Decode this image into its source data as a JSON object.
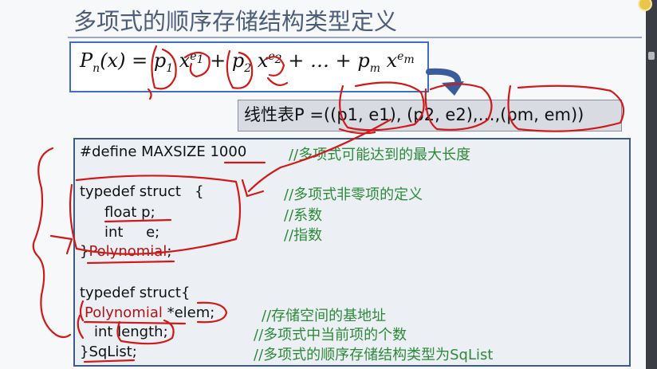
{
  "slide": {
    "title": "多项式的顺序存储结构类型定义"
  },
  "formula": {
    "lhs": "P",
    "lhs_sub": "n",
    "lhs_arg": "(x) = ",
    "t1_coef": "p",
    "t1_sub": "1",
    "t1_var": " x",
    "t1_exp": "e",
    "t1_exp_sub": "1",
    "plus1": " + ",
    "t2_coef": "p",
    "t2_sub": "2",
    "t2_var": " x",
    "t2_exp": "e",
    "t2_exp_sub": "2",
    "middle": " + … + ",
    "tm_coef": "p",
    "tm_sub": "m",
    "tm_var": " x",
    "tm_exp": "e",
    "tm_exp_sub": "m"
  },
  "linear_list": {
    "text": "线性表P =((p1, e1), (p2, e2),…,(pm, em))"
  },
  "code": {
    "line1": "#define MAXSIZE 1000",
    "line1_comment": "//多项式可能达到的最大长度",
    "line2": "typedef struct   {",
    "line2_comment": "//多项式非零项的定义",
    "line3": "float p;",
    "line3_comment": "//系数",
    "line4": "int     e;",
    "line4_comment": "//指数",
    "line5_brace": "}",
    "line5_name": "Polynomial",
    "line5_end": ";",
    "line6": "typedef struct{",
    "line7_type": "Polynomial",
    "line7_rest": " *elem;",
    "line7_comment": "//存储空间的基地址",
    "line8": "int length;",
    "line8_comment": "//多项式中当前项的个数",
    "line9": "}SqList;",
    "line9_comment": "//多项式的顺序存储结构类型为SqList"
  },
  "colors": {
    "title": "#4b5d78",
    "formula_border": "#3e6fc2",
    "code_border": "#3d5b86",
    "comment": "#2c8a3a",
    "annotation_ink": "#d01a1a",
    "keyword_red": "#b01515",
    "arrow": "#3a5c9c"
  }
}
